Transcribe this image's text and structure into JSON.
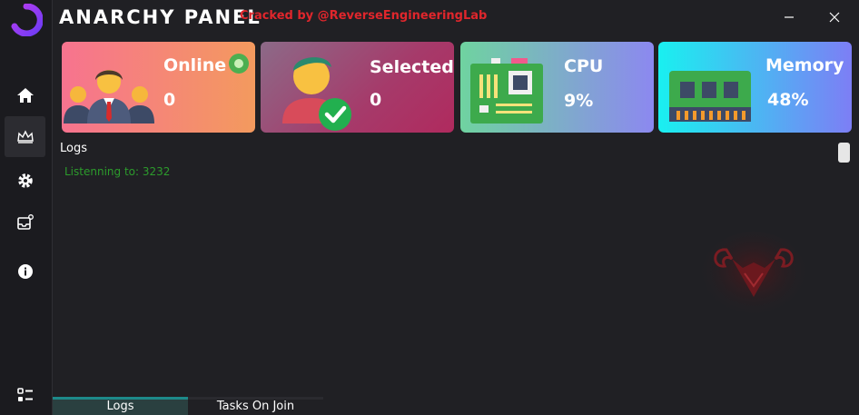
{
  "app": {
    "title": "ANARCHY PANEL",
    "cracked_by": "Cracked by @ReverseEngineeringLab"
  },
  "sidebar": {
    "items": [
      {
        "icon": "home-icon"
      },
      {
        "icon": "crown-icon"
      },
      {
        "icon": "gear-icon"
      },
      {
        "icon": "inbox-settings-icon"
      },
      {
        "icon": "info-icon"
      },
      {
        "icon": "list-icon"
      }
    ]
  },
  "cards": {
    "online": {
      "label": "Online",
      "value": "0",
      "colors": [
        "#f7738f",
        "#f39a5e"
      ]
    },
    "selected": {
      "label": "Selected",
      "value": "0",
      "colors": [
        "#9b5a7c",
        "#b52a60"
      ]
    },
    "cpu": {
      "label": "CPU",
      "value": "9%",
      "colors": [
        "#6fd3a0",
        "#8c88f0"
      ]
    },
    "memory": {
      "label": "Memory",
      "value": "48%",
      "colors": [
        "#19f0f0",
        "#7d7ef5"
      ]
    }
  },
  "logs": {
    "title": "Logs",
    "lines": [
      "Listenning to: 3232"
    ]
  },
  "tabs": [
    {
      "label": "Logs",
      "active": true
    },
    {
      "label": "Tasks On Join",
      "active": false
    }
  ]
}
